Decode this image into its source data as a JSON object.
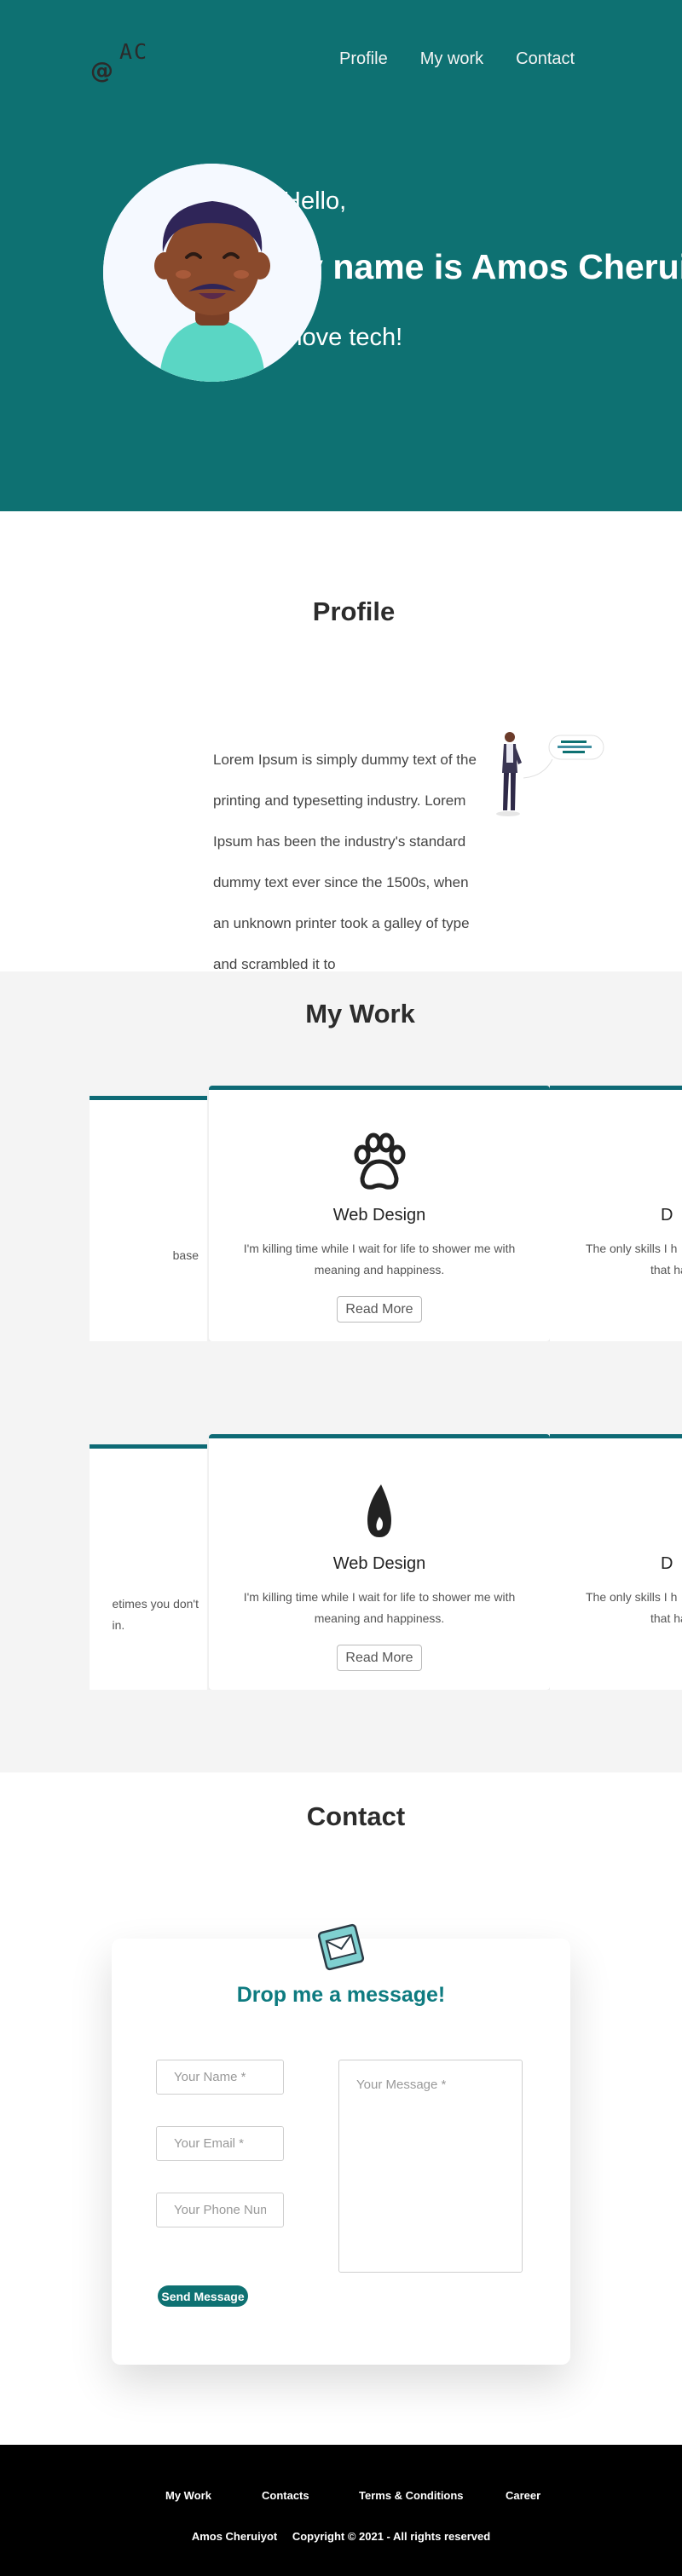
{
  "header": {
    "logo_top": "AC",
    "logo_symbol": "@",
    "nav": [
      "Profile",
      "My work",
      "Contact"
    ]
  },
  "hero": {
    "greeting": "Hello,",
    "name": "My name is Amos Cheruiyot",
    "tagline": "I love tech!"
  },
  "profile": {
    "title": "Profile",
    "text": "Lorem Ipsum is simply dummy text of the printing and typesetting industry. Lorem Ipsum has been the industry's standard dummy text ever since the 1500s, when an unknown printer took a galley of type and scrambled it to"
  },
  "work": {
    "title": "My Work",
    "row1": {
      "left_clip": "base",
      "main": {
        "icon": "paw-icon",
        "title": "Web Design",
        "description": "I'm killing time while I wait for life to shower me with meaning and happiness.",
        "button": "Read More"
      },
      "right_title_clip": "D",
      "right_text_clip": [
        "The only skills I h",
        "that hav"
      ]
    },
    "row2": {
      "left_clip": [
        "etimes you don't",
        "in."
      ],
      "main": {
        "icon": "drop-icon",
        "title": "Web Design",
        "description": "I'm killing time while I wait for life to shower me with meaning and happiness.",
        "button": "Read More"
      },
      "right_title_clip": "D",
      "right_text_clip": [
        "The only skills I h",
        "that hav"
      ]
    }
  },
  "contact": {
    "title": "Contact",
    "form_title": "Drop me a message!",
    "name_placeholder": "Your Name *",
    "email_placeholder": "Your Email *",
    "phone_placeholder": "Your Phone Number *",
    "message_placeholder": "Your Message *",
    "send_label": "Send Message"
  },
  "footer": {
    "links": [
      "My Work",
      "Contacts",
      "Terms & Conditions",
      "Career"
    ],
    "author": "Amos Cheruiyot",
    "copyright": "Copyright © 2021 - All rights reserved"
  },
  "colors": {
    "brand": "#0e7172",
    "accent_text": "#0e7b80",
    "footer_bg": "#000000",
    "work_bg": "#f4f4f4"
  }
}
